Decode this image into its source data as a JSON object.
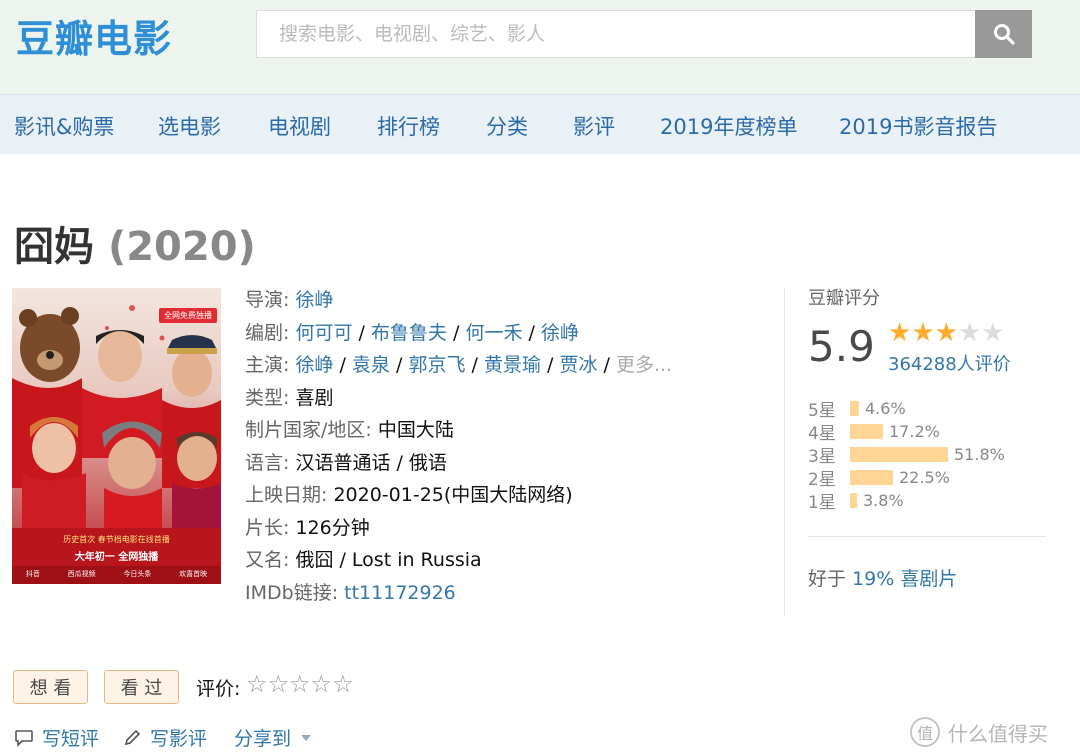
{
  "header": {
    "logo": "豆瓣电影",
    "search_placeholder": "搜索电影、电视剧、综艺、影人"
  },
  "nav": [
    "影讯&购票",
    "选电影",
    "电视剧",
    "排行榜",
    "分类",
    "影评",
    "2019年度榜单",
    "2019书影音报告"
  ],
  "movie": {
    "title": "囧妈",
    "year": "(2020)",
    "poster": {
      "badge": "全网免费独播",
      "tagline1": "历史首次 春节档电影在线首播",
      "tagline2": "大年初一  全网独播",
      "logos": [
        "抖音",
        "西瓜视频",
        "今日头条",
        "欢喜首映"
      ]
    }
  },
  "info": {
    "director_label": "导演",
    "director": "徐峥",
    "writers_label": "编剧",
    "writers": [
      "何可可",
      "布鲁鲁夫",
      "何一禾",
      "徐峥"
    ],
    "cast_label": "主演",
    "cast": [
      "徐峥",
      "袁泉",
      "郭京飞",
      "黄景瑜",
      "贾冰"
    ],
    "cast_more": "更多...",
    "genre_label": "类型:",
    "genre": "喜剧",
    "country_label": "制片国家/地区:",
    "country": "中国大陆",
    "language_label": "语言:",
    "language": "汉语普通话 / 俄语",
    "release_label": "上映日期:",
    "release": "2020-01-25(中国大陆网络)",
    "runtime_label": "片长:",
    "runtime": "126分钟",
    "aka_label": "又名:",
    "aka": "俄囧 / Lost in Russia",
    "imdb_label": "IMDb链接",
    "imdb": "tt11172926"
  },
  "rating": {
    "title": "豆瓣评分",
    "score": "5.9",
    "stars_filled": 3,
    "stars_total": 5,
    "votes": "364288人评价",
    "distribution": [
      {
        "label": "5星",
        "pct": "4.6%",
        "value": 4.6
      },
      {
        "label": "4星",
        "pct": "17.2%",
        "value": 17.2
      },
      {
        "label": "3星",
        "pct": "51.8%",
        "value": 51.8
      },
      {
        "label": "2星",
        "pct": "22.5%",
        "value": 22.5
      },
      {
        "label": "1星",
        "pct": "3.8%",
        "value": 3.8
      }
    ],
    "better_prefix": "好于 ",
    "better_link": "19% 喜剧片"
  },
  "actions": {
    "want": "想 看",
    "seen": "看 过",
    "rate_label": "评价:",
    "rate_stars": "☆☆☆☆☆"
  },
  "bottom": {
    "short_review": "写短评",
    "review": "写影评",
    "share": "分享到"
  },
  "watermark": "什么值得买",
  "watermark_mark": "值"
}
